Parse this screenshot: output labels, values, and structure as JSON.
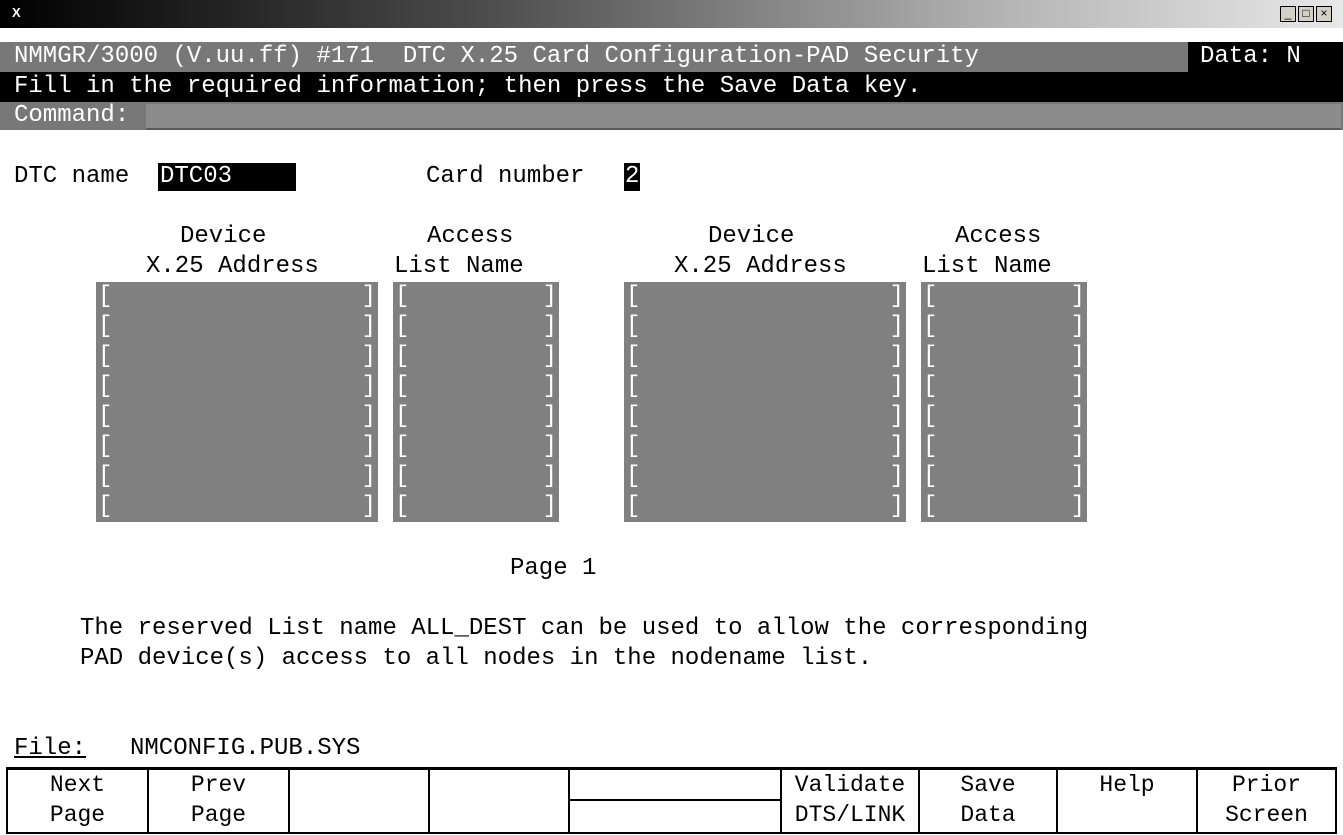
{
  "window": {
    "icon_label": "X",
    "buttons": {
      "minimize": "_",
      "maximize": "□",
      "close": "×"
    }
  },
  "header": {
    "screen_line": "NMMGR/3000 (V.uu.ff) #171  DTC X.25 Card Configuration-PAD Security",
    "data_flag": "Data: N",
    "instruction": "Fill in the required information; then press the Save Data key.",
    "command_label": "Command:",
    "command_value": ""
  },
  "form": {
    "dtc_name_label": "DTC name",
    "dtc_name_value": "DTC03",
    "card_number_label": "Card number",
    "card_number_value": "2",
    "left_group": {
      "address_header_1": "Device",
      "address_header_2": "X.25 Address",
      "list_header_1": "Access",
      "list_header_2": "List Name"
    },
    "right_group": {
      "address_header_1": "Device",
      "address_header_2": "X.25 Address",
      "list_header_1": "Access",
      "list_header_2": "List Name"
    },
    "rows": 8,
    "open_bracket": "[",
    "close_bracket": "]",
    "page_label": "Page 1",
    "note_line1": "The reserved List name ALL_DEST can be used to allow the corresponding",
    "note_line2": "PAD device(s) access to all nodes in the nodename list."
  },
  "file": {
    "label": "File:",
    "value": "NMCONFIG.PUB.SYS"
  },
  "function_keys": [
    {
      "line1": "Next",
      "line2": "Page"
    },
    {
      "line1": "Prev",
      "line2": "Page"
    },
    {
      "line1": "",
      "line2": ""
    },
    {
      "line1": "",
      "line2": ""
    },
    {
      "line1": "",
      "line2": ""
    },
    {
      "line1": "Validate",
      "line2": "DTS/LINK"
    },
    {
      "line1": "Save",
      "line2": "Data"
    },
    {
      "line1": "Help",
      "line2": ""
    },
    {
      "line1": "Prior",
      "line2": "Screen"
    }
  ]
}
